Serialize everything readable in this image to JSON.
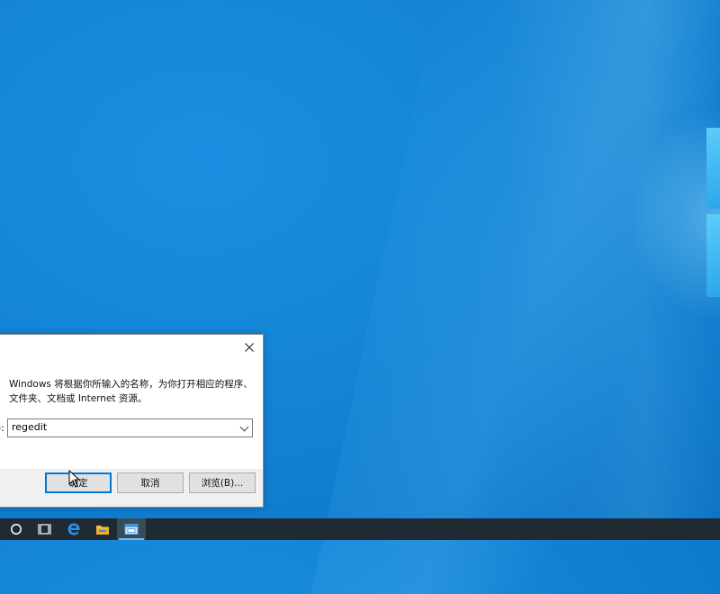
{
  "colors": {
    "desktop": "#1686d8",
    "taskbar": "#1f2a33",
    "accent": "#0078d7"
  },
  "run_dialog": {
    "description_line1": "Windows 将根据你所输入的名称，为你打开相应的程序、",
    "description_line2": "文件夹、文档或 Internet 资源。",
    "open_label": "):",
    "input_value": "regedit",
    "ok_label": "确定",
    "cancel_label": "取消",
    "browse_label": "浏览(B)..."
  },
  "taskbar": {
    "items": [
      {
        "icon": "cortana-search-icon"
      },
      {
        "icon": "task-view-icon"
      },
      {
        "icon": "edge-icon"
      },
      {
        "icon": "file-explorer-icon"
      },
      {
        "icon": "run-app-icon",
        "active": true
      }
    ]
  }
}
